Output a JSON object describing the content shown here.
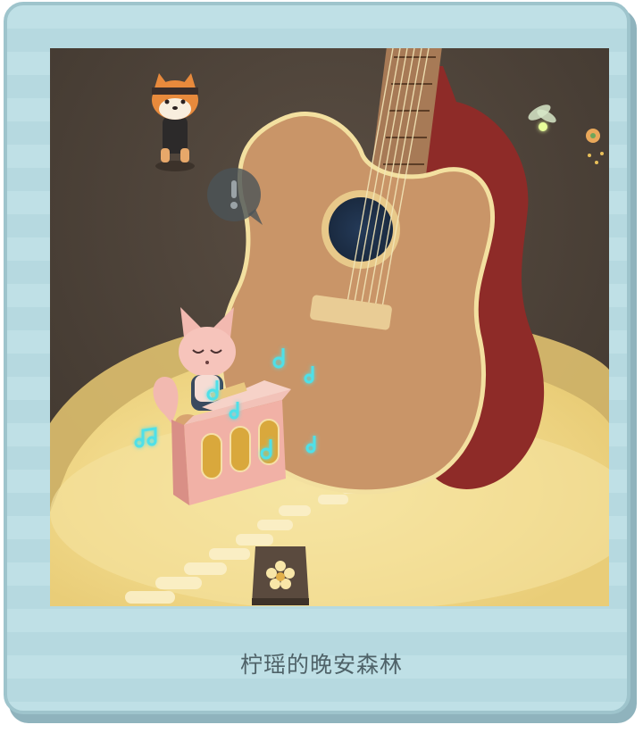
{
  "card": {
    "caption": "柠瑶的晚安森林"
  },
  "scene": {
    "icons": {
      "alert_bubble": "exclamation-bubble-icon",
      "flower_tile": "flower-icon",
      "firefly": "firefly-icon",
      "music_notes": "music-note-icon"
    },
    "characters": [
      "shiba-dog-character",
      "pink-fox-character"
    ]
  },
  "colors": {
    "card_background": "#bfe0e6",
    "card_border": "#9ec4cc",
    "caption_text": "#4f6268",
    "ground_dark": "#4a4036",
    "sand": "#f3dd8a",
    "guitar_body": "#c99568",
    "guitar_back": "#8e2b28",
    "piano_pink": "#f2b9b0",
    "note_glow": "#4fe0e8"
  }
}
